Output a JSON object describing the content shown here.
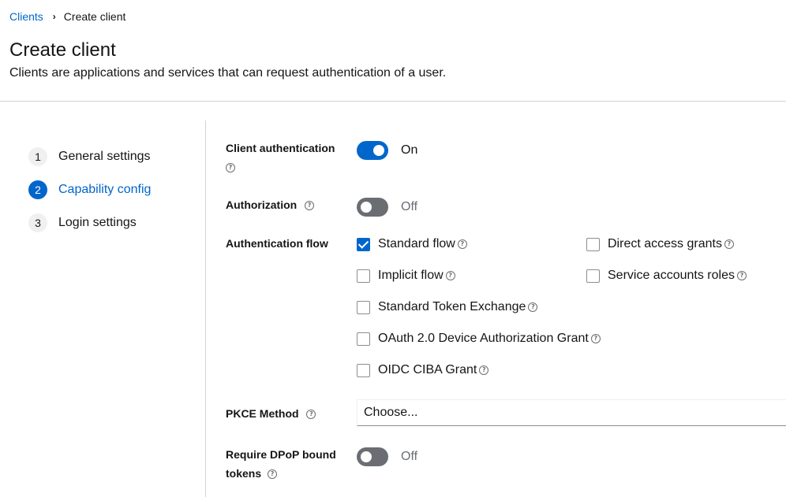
{
  "breadcrumb": {
    "parent": "Clients",
    "current": "Create client"
  },
  "header": {
    "title": "Create client",
    "description": "Clients are applications and services that can request authentication of a user."
  },
  "wizard": {
    "steps": [
      {
        "number": "1",
        "label": "General settings",
        "current": false
      },
      {
        "number": "2",
        "label": "Capability config",
        "current": true
      },
      {
        "number": "3",
        "label": "Login settings",
        "current": false
      }
    ]
  },
  "form": {
    "client_authentication": {
      "label": "Client authentication",
      "state": "On"
    },
    "authorization": {
      "label": "Authorization",
      "state": "Off"
    },
    "authentication_flow": {
      "label": "Authentication flow",
      "options": [
        {
          "label": "Standard flow",
          "checked": true
        },
        {
          "label": "Direct access grants",
          "checked": false
        },
        {
          "label": "Implicit flow",
          "checked": false
        },
        {
          "label": "Service accounts roles",
          "checked": false
        },
        {
          "label": "Standard Token Exchange",
          "checked": false
        },
        {
          "label": "OAuth 2.0 Device Authorization Grant",
          "checked": false
        },
        {
          "label": "OIDC CIBA Grant",
          "checked": false
        }
      ]
    },
    "pkce_method": {
      "label": "PKCE Method",
      "value": "Choose..."
    },
    "dpop": {
      "label_line1": "Require DPoP bound",
      "label_line2": "tokens",
      "state": "Off"
    }
  },
  "icons": {
    "help": "help-circle-icon",
    "breadcrumb_separator": "chevron-right-icon"
  },
  "colors": {
    "accent": "#0066cc",
    "toggle_off": "#6a6e73"
  }
}
